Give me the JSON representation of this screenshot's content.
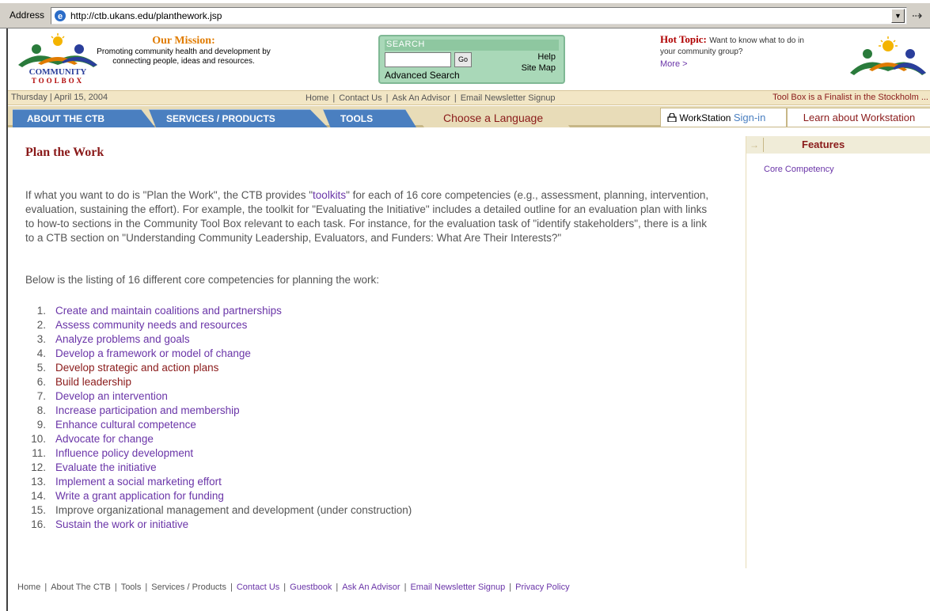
{
  "browser": {
    "address_label": "Address",
    "url": "http://ctb.ukans.edu/planthework.jsp",
    "dropdown_glyph": "▼",
    "go_glyph": "⇢"
  },
  "header": {
    "logo_text": "COMMUNITY",
    "logo_subtext": "TOOLBOX",
    "mission_title": "Our Mission:",
    "mission_text": "Promoting community health and development by connecting people, ideas and resources.",
    "search_label": "SEARCH",
    "search_value": "",
    "search_go": "Go",
    "search_help": "Help",
    "search_sitemap": "Site Map",
    "search_advanced": "Advanced Search",
    "hot_topic_title": "Hot Topic:",
    "hot_topic_text": "Want to know what to do in your community group?",
    "hot_topic_more": "More >"
  },
  "datebar": {
    "date": "Thursday | April 15, 2004",
    "links": [
      "Home",
      "Contact Us",
      "Ask An Advisor",
      "Email Newsletter Signup"
    ],
    "ticker": "Tool Box is a Finalist in the Stockholm ..."
  },
  "nav": {
    "about": "ABOUT THE CTB",
    "services": "SERVICES / PRODUCTS",
    "tools": "TOOLS",
    "language": "Choose a Language",
    "workstation": "WorkStation",
    "signin": "Sign-in",
    "learn": "Learn about Workstation"
  },
  "main": {
    "title": "Plan the Work",
    "intro_before": "If what you want to do is \"Plan the Work\", the CTB provides \"",
    "intro_link": "toolkits",
    "intro_after": "\" for each of 16 core competencies (e.g., assessment, planning, intervention, evaluation, sustaining the effort). For example, the toolkit for \"Evaluating the Initiative\" includes a detailed outline for an evaluation plan with links to how-to sections in the Community Tool Box relevant to each task. For instance, for the evaluation task of \"identify stakeholders\", there is a link to a CTB section on \"Understanding Community Leadership, Evaluators, and Funders: What Are Their Interests?\"",
    "listing_text": "Below is the listing of 16 different core competencies for planning the work:",
    "competencies": [
      {
        "num": "1.",
        "label": "Create and maintain coalitions and partnerships"
      },
      {
        "num": "2.",
        "label": "Assess community needs and resources"
      },
      {
        "num": "3.",
        "label": "Analyze problems and goals"
      },
      {
        "num": "4.",
        "label": "Develop a framework or model of change"
      },
      {
        "num": "5.",
        "label": "Develop strategic and action plans"
      },
      {
        "num": "6.",
        "label": "Build leadership"
      },
      {
        "num": "7.",
        "label": "Develop an intervention"
      },
      {
        "num": "8.",
        "label": "Increase participation and membership"
      },
      {
        "num": "9.",
        "label": "Enhance cultural competence"
      },
      {
        "num": "10.",
        "label": "Advocate for change"
      },
      {
        "num": "11.",
        "label": "Influence policy development"
      },
      {
        "num": "12.",
        "label": "Evaluate the initiative"
      },
      {
        "num": "13.",
        "label": "Implement a social marketing effort"
      },
      {
        "num": "14.",
        "label": "Write a grant application for funding"
      },
      {
        "num": "15.",
        "label": "Improve organizational management and development (under construction)"
      },
      {
        "num": "16.",
        "label": "Sustain the work or initiative"
      }
    ]
  },
  "sidebar": {
    "arrow": "→",
    "title": "Features",
    "item": "Core Competency"
  },
  "footer": {
    "links": [
      "Home",
      "About The CTB",
      "Tools",
      "Services / Products",
      "Contact Us",
      "Guestbook",
      "Ask An Advisor",
      "Email Newsletter Signup",
      "Privacy Policy"
    ]
  },
  "colors": {
    "nav_blue": "#4a7fc0",
    "link_purple": "#6a35a8",
    "title_maroon": "#8a1a1a",
    "beige": "#f2e6c5"
  }
}
